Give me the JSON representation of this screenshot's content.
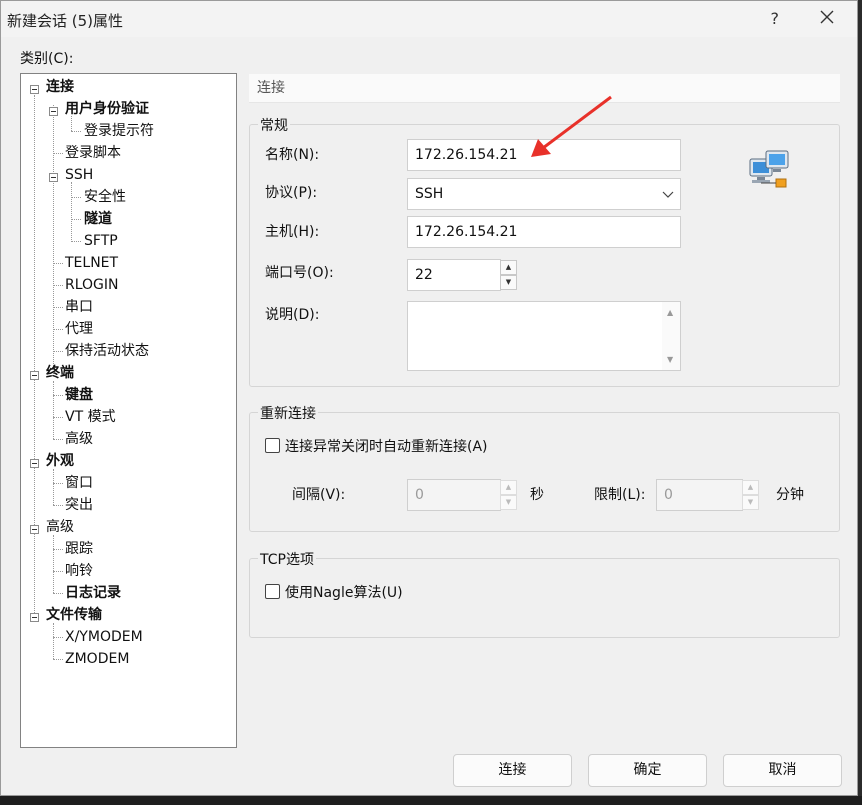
{
  "window": {
    "title": "新建会话 (5)属性",
    "help": "?"
  },
  "category_label": "类别(C):",
  "tree": {
    "connection": "连接",
    "user_auth": "用户身份验证",
    "login_prompt": "登录提示符",
    "login_script": "登录脚本",
    "ssh": "SSH",
    "security": "安全性",
    "tunnel": "隧道",
    "sftp": "SFTP",
    "telnet": "TELNET",
    "rlogin": "RLOGIN",
    "serial": "串口",
    "proxy": "代理",
    "keepalive": "保持活动状态",
    "terminal": "终端",
    "keyboard": "键盘",
    "vt_mode": "VT 模式",
    "terminal_advanced": "高级",
    "appearance": "外观",
    "window": "窗口",
    "highlight": "突出",
    "advanced": "高级",
    "trace": "跟踪",
    "bell": "响铃",
    "logging": "日志记录",
    "file_transfer": "文件传输",
    "xymodem": "X/YMODEM",
    "zmodem": "ZMODEM"
  },
  "panel": {
    "header": "连接",
    "general": {
      "title": "常规",
      "name_label": "名称(N):",
      "name_value": "172.26.154.21",
      "protocol_label": "协议(P):",
      "protocol_value": "SSH",
      "host_label": "主机(H):",
      "host_value": "172.26.154.21",
      "port_label": "端口号(O):",
      "port_value": "22",
      "desc_label": "说明(D):",
      "desc_value": ""
    },
    "reconnect": {
      "title": "重新连接",
      "auto_reconnect_label": "连接异常关闭时自动重新连接(A)",
      "interval_label": "间隔(V):",
      "interval_value": "0",
      "interval_unit": "秒",
      "limit_label": "限制(L):",
      "limit_value": "0",
      "limit_unit": "分钟"
    },
    "tcp": {
      "title": "TCP选项",
      "nagle_label": "使用Nagle算法(U)"
    }
  },
  "buttons": {
    "connect": "连接",
    "ok": "确定",
    "cancel": "取消"
  },
  "colors": {
    "arrow": "#e8312a",
    "accent": "#1a73c9"
  }
}
